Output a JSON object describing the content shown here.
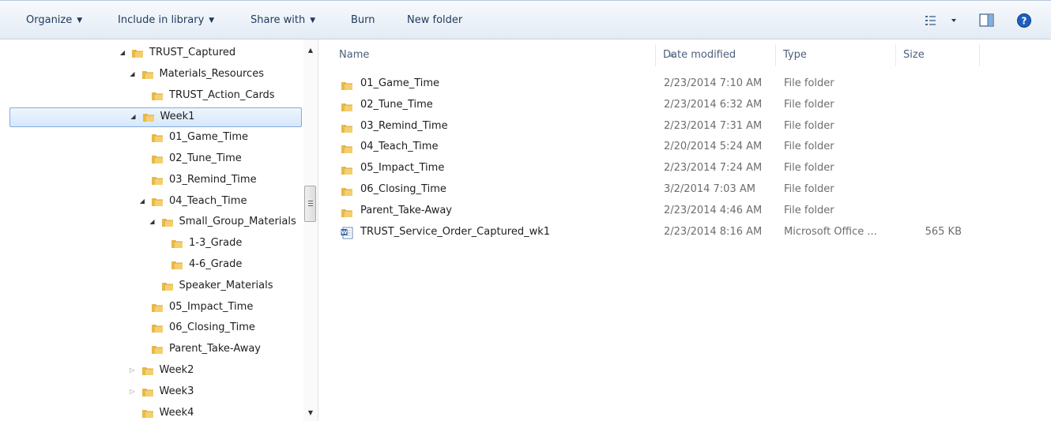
{
  "toolbar": {
    "organize": "Organize",
    "include": "Include in library",
    "share": "Share with",
    "burn": "Burn",
    "new_folder": "New folder"
  },
  "tree": [
    {
      "label": "TRUST_Captured",
      "state": "open"
    },
    {
      "label": "Materials_Resources",
      "state": "open"
    },
    {
      "label": "TRUST_Action_Cards",
      "state": "none"
    },
    {
      "label": "Week1",
      "state": "open",
      "selected": true
    },
    {
      "label": "01_Game_Time",
      "state": "none"
    },
    {
      "label": "02_Tune_Time",
      "state": "none"
    },
    {
      "label": "03_Remind_Time",
      "state": "none"
    },
    {
      "label": "04_Teach_Time",
      "state": "open"
    },
    {
      "label": "Small_Group_Materials",
      "state": "open"
    },
    {
      "label": "1-3_Grade",
      "state": "none"
    },
    {
      "label": "4-6_Grade",
      "state": "none"
    },
    {
      "label": "Speaker_Materials",
      "state": "none"
    },
    {
      "label": "05_Impact_Time",
      "state": "none"
    },
    {
      "label": "06_Closing_Time",
      "state": "none"
    },
    {
      "label": "Parent_Take-Away",
      "state": "none"
    },
    {
      "label": "Week2",
      "state": "closed"
    },
    {
      "label": "Week3",
      "state": "closed"
    },
    {
      "label": "Week4",
      "state": "none"
    }
  ],
  "columns": {
    "name": "Name",
    "date": "Date modified",
    "type": "Type",
    "size": "Size"
  },
  "files": [
    {
      "name": "01_Game_Time",
      "date": "2/23/2014 7:10 AM",
      "type": "File folder",
      "size": "",
      "kind": "folder"
    },
    {
      "name": "02_Tune_Time",
      "date": "2/23/2014 6:32 AM",
      "type": "File folder",
      "size": "",
      "kind": "folder"
    },
    {
      "name": "03_Remind_Time",
      "date": "2/23/2014 7:31 AM",
      "type": "File folder",
      "size": "",
      "kind": "folder"
    },
    {
      "name": "04_Teach_Time",
      "date": "2/20/2014 5:24 AM",
      "type": "File folder",
      "size": "",
      "kind": "folder"
    },
    {
      "name": "05_Impact_Time",
      "date": "2/23/2014 7:24 AM",
      "type": "File folder",
      "size": "",
      "kind": "folder"
    },
    {
      "name": "06_Closing_Time",
      "date": "3/2/2014 7:03 AM",
      "type": "File folder",
      "size": "",
      "kind": "folder"
    },
    {
      "name": "Parent_Take-Away",
      "date": "2/23/2014 4:46 AM",
      "type": "File folder",
      "size": "",
      "kind": "folder"
    },
    {
      "name": "TRUST_Service_Order_Captured_wk1",
      "date": "2/23/2014 8:16 AM",
      "type": "Microsoft Office ...",
      "size": "565 KB",
      "kind": "word-doc"
    }
  ],
  "colors": {
    "folder": "#e8b948",
    "selection_border": "#84acdd",
    "toolbar_text": "#1e395b"
  }
}
